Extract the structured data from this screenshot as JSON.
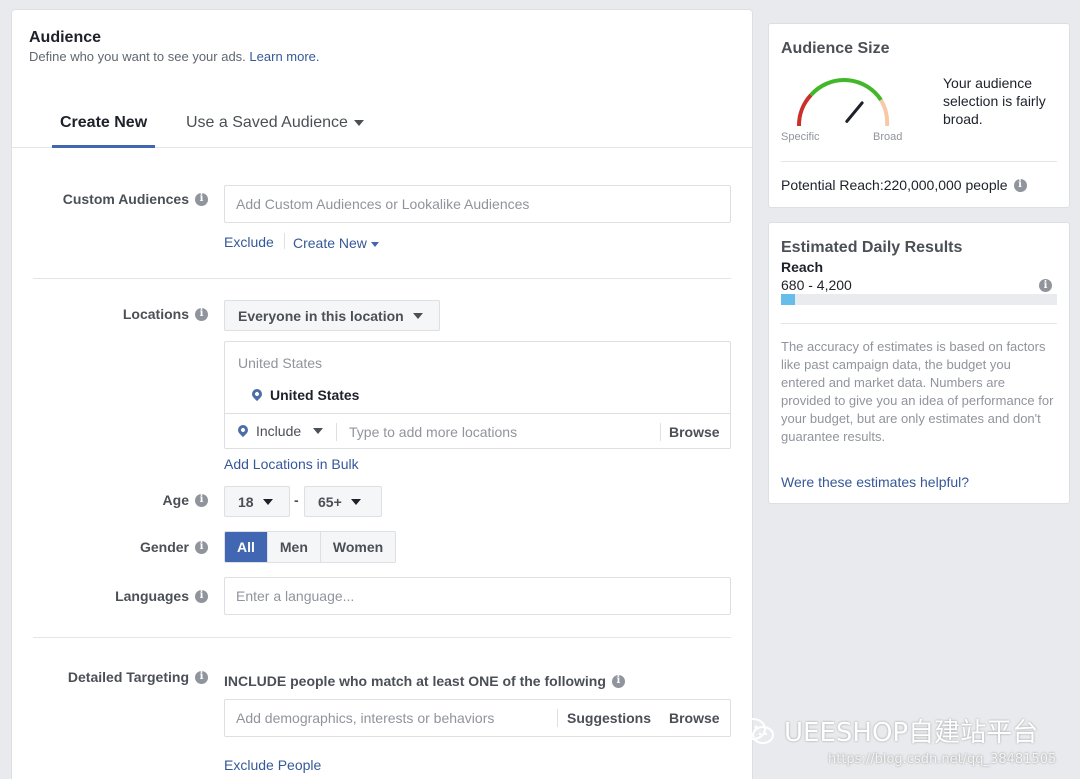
{
  "audience": {
    "title": "Audience",
    "subtitle": "Define who you want to see your ads.",
    "learn_more": "Learn more."
  },
  "tabs": {
    "create_new": "Create New",
    "saved": "Use a Saved Audience"
  },
  "custom_audiences": {
    "label": "Custom Audiences",
    "placeholder": "Add Custom Audiences or Lookalike Audiences",
    "exclude": "Exclude",
    "create_new": "Create New"
  },
  "locations": {
    "label": "Locations",
    "dropdown": "Everyone in this location",
    "country_header": "United States",
    "selected": "United States",
    "include": "Include",
    "placeholder": "Type to add more locations",
    "browse": "Browse",
    "bulk": "Add Locations in Bulk"
  },
  "age": {
    "label": "Age",
    "min": "18",
    "dash": "-",
    "max": "65+"
  },
  "gender": {
    "label": "Gender",
    "options": [
      "All",
      "Men",
      "Women"
    ],
    "selected": "All"
  },
  "languages": {
    "label": "Languages",
    "placeholder": "Enter a language..."
  },
  "detailed": {
    "label": "Detailed Targeting",
    "include_text": "INCLUDE people who match at least ONE of the following",
    "placeholder": "Add demographics, interests or behaviors",
    "suggestions": "Suggestions",
    "browse": "Browse",
    "exclude": "Exclude People"
  },
  "audience_size": {
    "title": "Audience Size",
    "specific": "Specific",
    "broad": "Broad",
    "description": "Your audience selection is fairly broad.",
    "potential_reach": "Potential Reach:220,000,000 people",
    "gauge_level": 0.72
  },
  "daily_results": {
    "title": "Estimated Daily Results",
    "reach_label": "Reach",
    "reach_value": "680 - 4,200",
    "reach_fill": 0.05,
    "note": "The accuracy of estimates is based on factors like past campaign data, the budget you entered and market data. Numbers are provided to give you an idea of performance for your budget, but are only estimates and don't guarantee results.",
    "helpful": "Were these estimates helpful?"
  },
  "watermark": {
    "brand": "UEESHOP自建站平台",
    "url": "https://blog.csdn.net/qq_38481505"
  },
  "colors": {
    "accent": "#4267b2",
    "link": "#365899",
    "reach_bar": "#66bdec"
  }
}
